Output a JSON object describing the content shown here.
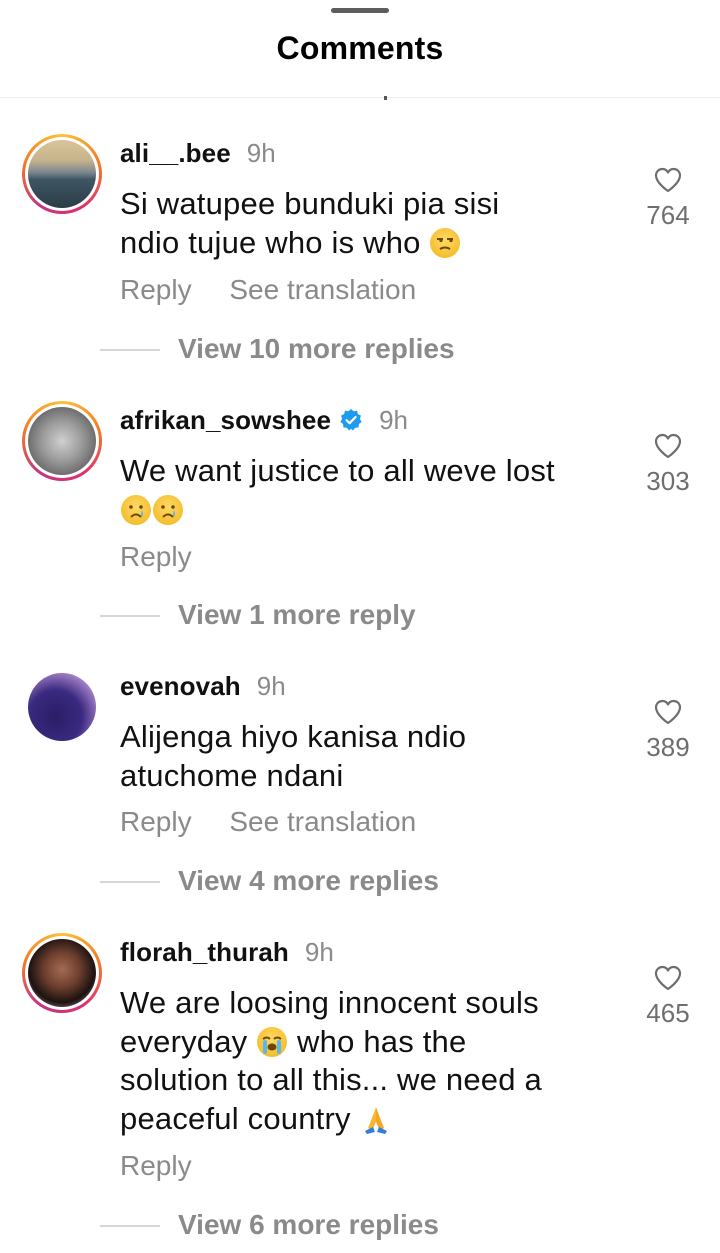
{
  "header": {
    "title": "Comments"
  },
  "comments": [
    {
      "username": "ali__.bee",
      "time": "9h",
      "verified": false,
      "text_lines": [
        "Si watupee bunduki pia sisi",
        "ndio tujue who is who"
      ],
      "emoji": [
        "unamused-face-emoji"
      ],
      "actions": [
        "Reply",
        "See translation"
      ],
      "likes": "764",
      "view_replies": "View 10 more replies"
    },
    {
      "username": "afrikan_sowshee",
      "time": "9h",
      "verified": true,
      "text_lines": [
        "We want justice to all weve lost"
      ],
      "emoji": [
        "crying-face-emoji",
        "crying-face-emoji"
      ],
      "actions": [
        "Reply"
      ],
      "likes": "303",
      "view_replies": "View 1 more reply"
    },
    {
      "username": "evenovah",
      "time": "9h",
      "verified": false,
      "text_lines": [
        "Alijenga hiyo kanisa ndio",
        "atuchome ndani"
      ],
      "emoji": [],
      "actions": [
        "Reply",
        "See translation"
      ],
      "likes": "389",
      "view_replies": "View 4 more replies"
    },
    {
      "username": "florah_thurah",
      "time": "9h",
      "verified": false,
      "text_lines": [
        "We are loosing innocent souls",
        "everyday",
        "who has the",
        "solution to all this... we need a",
        "peaceful country"
      ],
      "emoji": [
        "loudly-crying-face-emoji",
        "folded-hands-emoji"
      ],
      "actions": [
        "Reply"
      ],
      "likes": "465",
      "view_replies": "View 6 more replies"
    }
  ],
  "colors": {
    "text": "#111111",
    "muted": "#8a8a8a",
    "verified": "#1d9bf0",
    "story_ring": "#e1306c"
  }
}
